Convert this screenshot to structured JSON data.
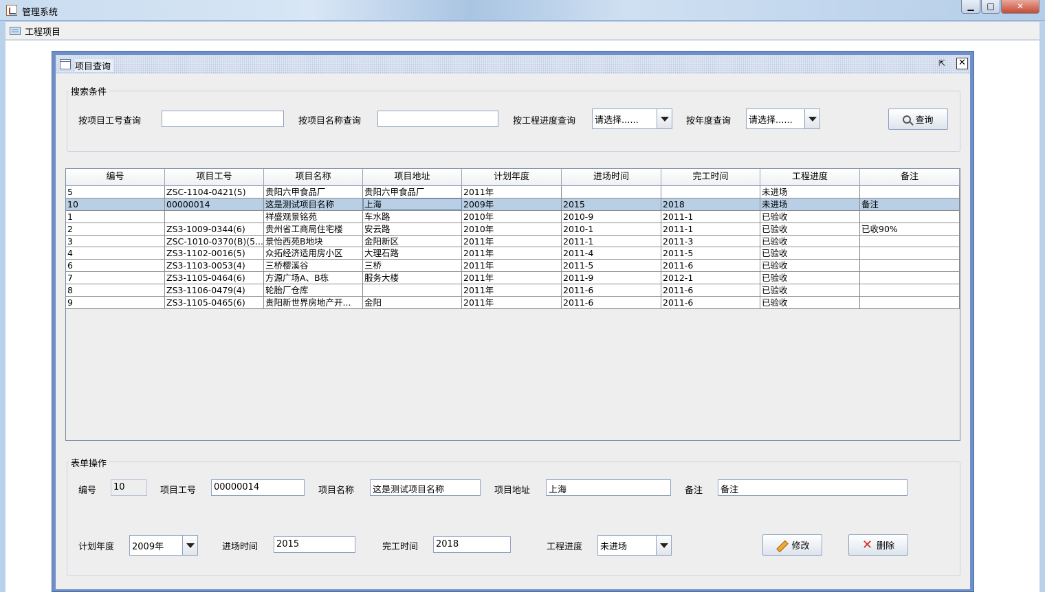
{
  "app": {
    "title": "管理系统",
    "minimize": "▁",
    "maximize": "□",
    "close": "✕"
  },
  "menubar": {
    "item": "工程项目"
  },
  "frame": {
    "title": "项目查询",
    "restore": "⇱",
    "close": "✕"
  },
  "search": {
    "legend": "搜索条件",
    "by_code_label": "按项目工号查询",
    "by_code_value": "",
    "by_name_label": "按项目名称查询",
    "by_name_value": "",
    "by_progress_label": "按工程进度查询",
    "by_progress_value": "请选择......",
    "by_year_label": "按年度查询",
    "by_year_value": "请选择......",
    "query_button": "查询"
  },
  "table": {
    "columns": [
      "编号",
      "项目工号",
      "项目名称",
      "项目地址",
      "计划年度",
      "进场时间",
      "完工时间",
      "工程进度",
      "备注"
    ],
    "rows": [
      [
        "5",
        "ZSC-1104-0421(5)",
        "贵阳六甲食品厂",
        "贵阳六甲食品厂",
        "2011年",
        "",
        "",
        "未进场",
        ""
      ],
      [
        "10",
        "00000014",
        "这是测试项目名称",
        "上海",
        "2009年",
        "2015",
        "2018",
        "未进场",
        "备注"
      ],
      [
        "1",
        "",
        "祥盛观景铭苑",
        "车水路",
        "2010年",
        "2010-9",
        "2011-1",
        "已验收",
        ""
      ],
      [
        "2",
        "ZS3-1009-0344(6)",
        "贵州省工商局住宅楼",
        "安云路",
        "2010年",
        "2010-1",
        "2011-1",
        "已验收",
        "已收90%"
      ],
      [
        "3",
        "ZSC-1010-0370(B)(5...",
        "景怡西苑B地块",
        "金阳新区",
        "2011年",
        "2011-1",
        "2011-3",
        "已验收",
        ""
      ],
      [
        "4",
        "ZS3-1102-0016(5)",
        "众拓经济适用房小区",
        "大理石路",
        "2011年",
        "2011-4",
        "2011-5",
        "已验收",
        ""
      ],
      [
        "6",
        "ZS3-1103-0053(4)",
        "三桥樱溪谷",
        "三桥",
        "2011年",
        "2011-5",
        "2011-6",
        "已验收",
        ""
      ],
      [
        "7",
        "ZS3-1105-0464(6)",
        "方源广场A、B栋",
        "服务大楼",
        "2011年",
        "2011-9",
        "2012-1",
        "已验收",
        ""
      ],
      [
        "8",
        "ZS3-1106-0479(4)",
        "轮胎厂仓库",
        "",
        "2011年",
        "2011-6",
        "2011-6",
        "已验收",
        ""
      ],
      [
        "9",
        "ZS3-1105-0465(6)",
        "贵阳新世界房地产开...",
        "金阳",
        "2011年",
        "2011-6",
        "2011-6",
        "已验收",
        ""
      ]
    ],
    "selected_index": 1
  },
  "form": {
    "legend": "表单操作",
    "id_label": "编号",
    "id_value": "10",
    "code_label": "项目工号",
    "code_value": "00000014",
    "name_label": "项目名称",
    "name_value": "这是测试项目名称",
    "addr_label": "项目地址",
    "addr_value": "上海",
    "note_label": "备注",
    "note_value": "备注",
    "year_label": "计划年度",
    "year_value": "2009年",
    "enter_label": "进场时间",
    "enter_value": "2015",
    "finish_label": "完工时间",
    "finish_value": "2018",
    "progress_label": "工程进度",
    "progress_value": "未进场",
    "edit_button": "修改",
    "delete_button": "删除"
  }
}
